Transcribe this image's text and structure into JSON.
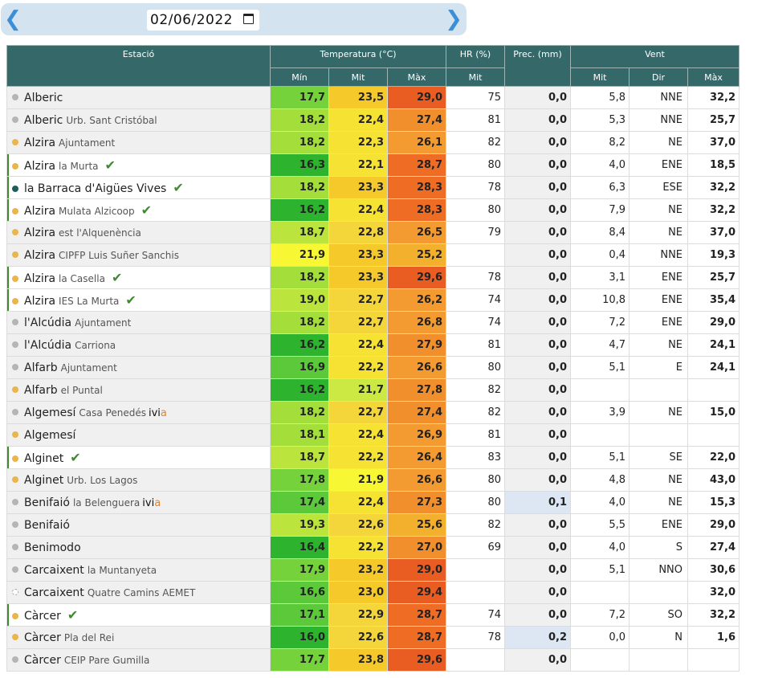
{
  "nav": {
    "date_value": "02/06/2022"
  },
  "colors": {
    "header_bg": "#356868",
    "ok_check": "#3f8a2e",
    "temp_scale": {
      "16.0": "#2db32d",
      "16.5": "#5cc93b",
      "17.5": "#75d23a",
      "18.0": "#a3de3a",
      "18.5": "#bbe43c",
      "19.5": "#cce943",
      "21.9": "#f7f734",
      "22.0": "#f5e233",
      "22.6": "#f4d53a",
      "23.0": "#f5c929",
      "25.0": "#f3b02c",
      "26.0": "#f39a30",
      "27.0": "#f18f2d",
      "28.0": "#ef6c25",
      "29.0": "#ea5d22"
    }
  },
  "headers": {
    "station": "Estació",
    "temperature": "Temperatura (°C)",
    "hr": "HR (%)",
    "prec": "Prec. (mm)",
    "wind": "Vent",
    "t_min": "Mín",
    "t_mit": "Mit",
    "t_max": "Màx",
    "hr_mit": "Mit",
    "w_mit": "Mit",
    "w_dir": "Dir",
    "w_max": "Màx"
  },
  "rows": [
    {
      "dot": "gray",
      "name": "Alberic",
      "sub": "",
      "check": false,
      "ivia": false,
      "hl": false,
      "tmin": "17,7",
      "tmit": "23,5",
      "tmax": "29,0",
      "hr": "75",
      "prec": "0,0",
      "wmit": "5,8",
      "wdir": "NNE",
      "wmax": "32,2"
    },
    {
      "dot": "gray",
      "name": "Alberic",
      "sub": "Urb. Sant Cristóbal",
      "check": false,
      "ivia": false,
      "hl": false,
      "tmin": "18,2",
      "tmit": "22,4",
      "tmax": "27,4",
      "hr": "81",
      "prec": "0,0",
      "wmit": "5,3",
      "wdir": "NNE",
      "wmax": "25,7"
    },
    {
      "dot": "yellow",
      "name": "Alzira",
      "sub": "Ajuntament",
      "check": false,
      "ivia": false,
      "hl": false,
      "tmin": "18,2",
      "tmit": "22,3",
      "tmax": "26,1",
      "hr": "82",
      "prec": "0,0",
      "wmit": "8,2",
      "wdir": "NE",
      "wmax": "37,0"
    },
    {
      "dot": "yellow",
      "name": "Alzira",
      "sub": "la Murta",
      "check": true,
      "ivia": false,
      "hl": true,
      "tmin": "16,3",
      "tmit": "22,1",
      "tmax": "28,7",
      "hr": "80",
      "prec": "0,0",
      "wmit": "4,0",
      "wdir": "ENE",
      "wmax": "18,5"
    },
    {
      "dot": "teal",
      "name": "la Barraca d'Aigües Vives",
      "sub": "",
      "check": true,
      "ivia": false,
      "hl": true,
      "tmin": "18,2",
      "tmit": "23,3",
      "tmax": "28,3",
      "hr": "78",
      "prec": "0,0",
      "wmit": "6,3",
      "wdir": "ESE",
      "wmax": "32,2"
    },
    {
      "dot": "yellow",
      "name": "Alzira",
      "sub": "Mulata Alzicoop",
      "check": true,
      "ivia": false,
      "hl": true,
      "tmin": "16,2",
      "tmit": "22,4",
      "tmax": "28,3",
      "hr": "80",
      "prec": "0,0",
      "wmit": "7,9",
      "wdir": "NE",
      "wmax": "32,2"
    },
    {
      "dot": "yellow",
      "name": "Alzira",
      "sub": "est l'Alquenència",
      "check": false,
      "ivia": false,
      "hl": false,
      "tmin": "18,7",
      "tmit": "22,8",
      "tmax": "26,5",
      "hr": "79",
      "prec": "0,0",
      "wmit": "8,4",
      "wdir": "NE",
      "wmax": "37,0"
    },
    {
      "dot": "yellow",
      "name": "Alzira",
      "sub": "CIPFP Luis Suñer Sanchis",
      "check": false,
      "ivia": false,
      "hl": false,
      "tmin": "21,9",
      "tmit": "23,3",
      "tmax": "25,2",
      "hr": "",
      "prec": "0,0",
      "wmit": "0,4",
      "wdir": "NNE",
      "wmax": "19,3"
    },
    {
      "dot": "yellow",
      "name": "Alzira",
      "sub": "la Casella",
      "check": true,
      "ivia": false,
      "hl": true,
      "tmin": "18,2",
      "tmit": "23,3",
      "tmax": "29,6",
      "hr": "78",
      "prec": "0,0",
      "wmit": "3,1",
      "wdir": "ENE",
      "wmax": "25,7"
    },
    {
      "dot": "yellow",
      "name": "Alzira",
      "sub": "IES La Murta",
      "check": true,
      "ivia": false,
      "hl": true,
      "tmin": "19,0",
      "tmit": "22,7",
      "tmax": "26,2",
      "hr": "74",
      "prec": "0,0",
      "wmit": "10,8",
      "wdir": "ENE",
      "wmax": "35,4"
    },
    {
      "dot": "gray",
      "name": "l'Alcúdia",
      "sub": "Ajuntament",
      "check": false,
      "ivia": false,
      "hl": false,
      "tmin": "18,2",
      "tmit": "22,7",
      "tmax": "26,8",
      "hr": "74",
      "prec": "0,0",
      "wmit": "7,2",
      "wdir": "ENE",
      "wmax": "29,0"
    },
    {
      "dot": "gray",
      "name": "l'Alcúdia",
      "sub": "Carriona",
      "check": false,
      "ivia": false,
      "hl": false,
      "tmin": "16,2",
      "tmit": "22,4",
      "tmax": "27,9",
      "hr": "81",
      "prec": "0,0",
      "wmit": "4,7",
      "wdir": "NE",
      "wmax": "24,1"
    },
    {
      "dot": "gray",
      "name": "Alfarb",
      "sub": "Ajuntament",
      "check": false,
      "ivia": false,
      "hl": false,
      "tmin": "16,9",
      "tmit": "22,2",
      "tmax": "26,6",
      "hr": "80",
      "prec": "0,0",
      "wmit": "5,1",
      "wdir": "E",
      "wmax": "24,1"
    },
    {
      "dot": "yellow",
      "name": "Alfarb",
      "sub": "el Puntal",
      "check": false,
      "ivia": false,
      "hl": false,
      "tmin": "16,2",
      "tmit": "21,7",
      "tmax": "27,8",
      "hr": "82",
      "prec": "0,0",
      "wmit": "",
      "wdir": "",
      "wmax": ""
    },
    {
      "dot": "gray",
      "name": "Algemesí",
      "sub": "Casa Penedés",
      "check": false,
      "ivia": true,
      "hl": false,
      "tmin": "18,2",
      "tmit": "22,7",
      "tmax": "27,4",
      "hr": "82",
      "prec": "0,0",
      "wmit": "3,9",
      "wdir": "NE",
      "wmax": "15,0"
    },
    {
      "dot": "yellow",
      "name": "Algemesí",
      "sub": "",
      "check": false,
      "ivia": false,
      "hl": false,
      "tmin": "18,1",
      "tmit": "22,4",
      "tmax": "26,9",
      "hr": "81",
      "prec": "0,0",
      "wmit": "",
      "wdir": "",
      "wmax": ""
    },
    {
      "dot": "yellow",
      "name": "Alginet",
      "sub": "",
      "check": true,
      "ivia": false,
      "hl": true,
      "tmin": "18,7",
      "tmit": "22,2",
      "tmax": "26,4",
      "hr": "83",
      "prec": "0,0",
      "wmit": "5,1",
      "wdir": "SE",
      "wmax": "22,0"
    },
    {
      "dot": "yellow",
      "name": "Alginet",
      "sub": "Urb. Los Lagos",
      "check": false,
      "ivia": false,
      "hl": false,
      "tmin": "17,8",
      "tmit": "21,9",
      "tmax": "26,6",
      "hr": "80",
      "prec": "0,0",
      "wmit": "4,8",
      "wdir": "NE",
      "wmax": "43,0"
    },
    {
      "dot": "gray",
      "name": "Benifaió",
      "sub": "la Belenguera",
      "check": false,
      "ivia": true,
      "hl": false,
      "tmin": "17,4",
      "tmit": "22,4",
      "tmax": "27,3",
      "hr": "80",
      "prec": "0,1",
      "wmit": "4,0",
      "wdir": "NE",
      "wmax": "15,3"
    },
    {
      "dot": "gray",
      "name": "Benifaió",
      "sub": "",
      "check": false,
      "ivia": false,
      "hl": false,
      "tmin": "19,3",
      "tmit": "22,6",
      "tmax": "25,6",
      "hr": "82",
      "prec": "0,0",
      "wmit": "5,5",
      "wdir": "ENE",
      "wmax": "29,0"
    },
    {
      "dot": "gray",
      "name": "Benimodo",
      "sub": "",
      "check": false,
      "ivia": false,
      "hl": false,
      "tmin": "16,4",
      "tmit": "22,2",
      "tmax": "27,0",
      "hr": "69",
      "prec": "0,0",
      "wmit": "4,0",
      "wdir": "S",
      "wmax": "27,4"
    },
    {
      "dot": "gray",
      "name": "Carcaixent",
      "sub": "la Muntanyeta",
      "check": false,
      "ivia": false,
      "hl": false,
      "tmin": "17,9",
      "tmit": "23,2",
      "tmax": "29,0",
      "hr": "",
      "prec": "0,0",
      "wmit": "5,1",
      "wdir": "NNO",
      "wmax": "30,6"
    },
    {
      "dot": "dashed",
      "name": "Carcaixent",
      "sub": "Quatre Camins AEMET",
      "check": false,
      "ivia": false,
      "hl": false,
      "tmin": "16,6",
      "tmit": "23,0",
      "tmax": "29,4",
      "hr": "",
      "prec": "0,0",
      "wmit": "",
      "wdir": "",
      "wmax": "32,0"
    },
    {
      "dot": "yellow",
      "name": "Càrcer",
      "sub": "",
      "check": true,
      "ivia": false,
      "hl": true,
      "tmin": "17,1",
      "tmit": "22,9",
      "tmax": "28,7",
      "hr": "74",
      "prec": "0,0",
      "wmit": "7,2",
      "wdir": "SO",
      "wmax": "32,2"
    },
    {
      "dot": "yellow",
      "name": "Càrcer",
      "sub": "Pla del Rei",
      "check": false,
      "ivia": false,
      "hl": false,
      "tmin": "16,0",
      "tmit": "22,6",
      "tmax": "28,7",
      "hr": "78",
      "prec": "0,2",
      "wmit": "0,0",
      "wdir": "N",
      "wmax": "1,6"
    },
    {
      "dot": "gray",
      "name": "Càrcer",
      "sub": "CEIP Pare Gumilla",
      "check": false,
      "ivia": false,
      "hl": false,
      "tmin": "17,7",
      "tmit": "23,8",
      "tmax": "29,6",
      "hr": "",
      "prec": "0,0",
      "wmit": "",
      "wdir": "",
      "wmax": ""
    }
  ]
}
